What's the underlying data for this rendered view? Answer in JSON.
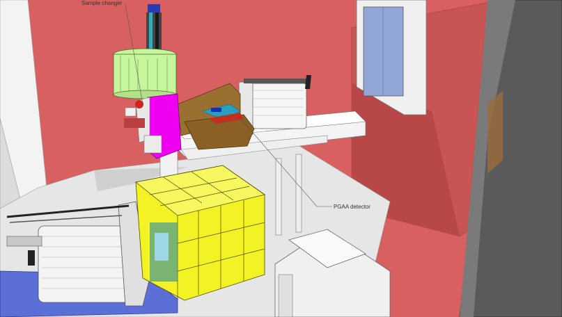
{
  "labels": {
    "sample_changer": "Sample changer",
    "pgaa_detector": "PGAA detector"
  },
  "colors": {
    "wall": "#d96060",
    "wall_dark": "#b84848",
    "floor": "#e4e4e4",
    "sample_changer": "#c6f59b",
    "sample_holder": "#f000f0",
    "detector_shield": "#f2f224",
    "magnet": "#9a7030",
    "base_plate": "#5b6fd6",
    "window": "#93a6d8"
  },
  "icons": [
    "window-icon"
  ]
}
